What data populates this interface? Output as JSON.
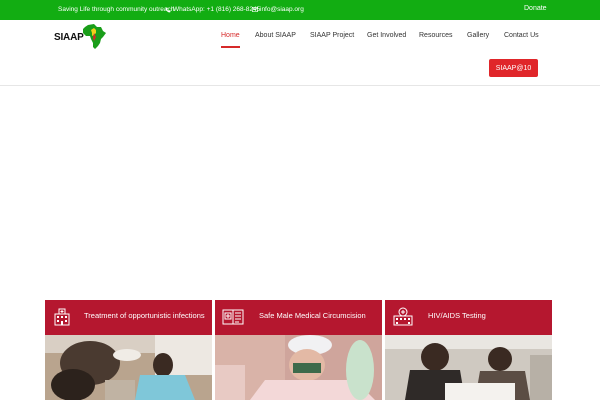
{
  "topbar": {
    "tagline": "Saving Life through community outreach",
    "whatsapp": "WhatsApp: +1 (816) 268-8245",
    "email": "info@siaap.org",
    "donate": "Donate",
    "icons": [
      "phone-icon",
      "mail-icon"
    ]
  },
  "logo": {
    "text": "SIAAP"
  },
  "nav": {
    "items": [
      "Home",
      "About SIAAP",
      "SIAAP Project",
      "Get Involved",
      "Resources",
      "Gallery",
      "Contact Us"
    ],
    "active": "Home",
    "cta": "SIAAP@10"
  },
  "cards": [
    {
      "title": "Treatment of opportunistic infections",
      "icon": "hospital-icon"
    },
    {
      "title": "Safe Male Medical Circumcision",
      "icon": "medical-book-icon"
    },
    {
      "title": "HIV/AIDS Testing",
      "icon": "clinic-icon"
    }
  ],
  "colors": {
    "topbar_green": "#12ad12",
    "accent_red": "#e0262a",
    "card_red": "#b5172f"
  }
}
